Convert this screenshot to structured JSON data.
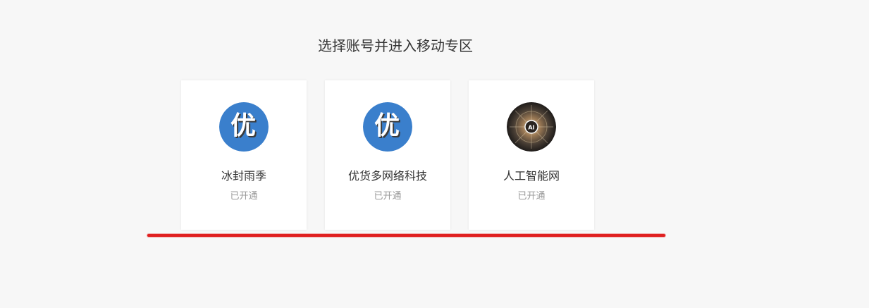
{
  "page": {
    "title": "选择账号并进入移动专区"
  },
  "accounts": [
    {
      "name": "冰封雨季",
      "status": "已开通",
      "avatar": {
        "icon": "you-logo-icon",
        "glyph": "优",
        "background": "#3a7fcc"
      }
    },
    {
      "name": "优货多网络科技",
      "status": "已开通",
      "avatar": {
        "icon": "you-logo-icon",
        "glyph": "优",
        "background": "#3a7fcc"
      }
    },
    {
      "name": "人工智能网",
      "status": "已开通",
      "avatar": {
        "icon": "ai-network-icon",
        "glyph": "AI",
        "background": "#2b2622"
      }
    }
  ],
  "annotation": {
    "color": "#e02020"
  }
}
